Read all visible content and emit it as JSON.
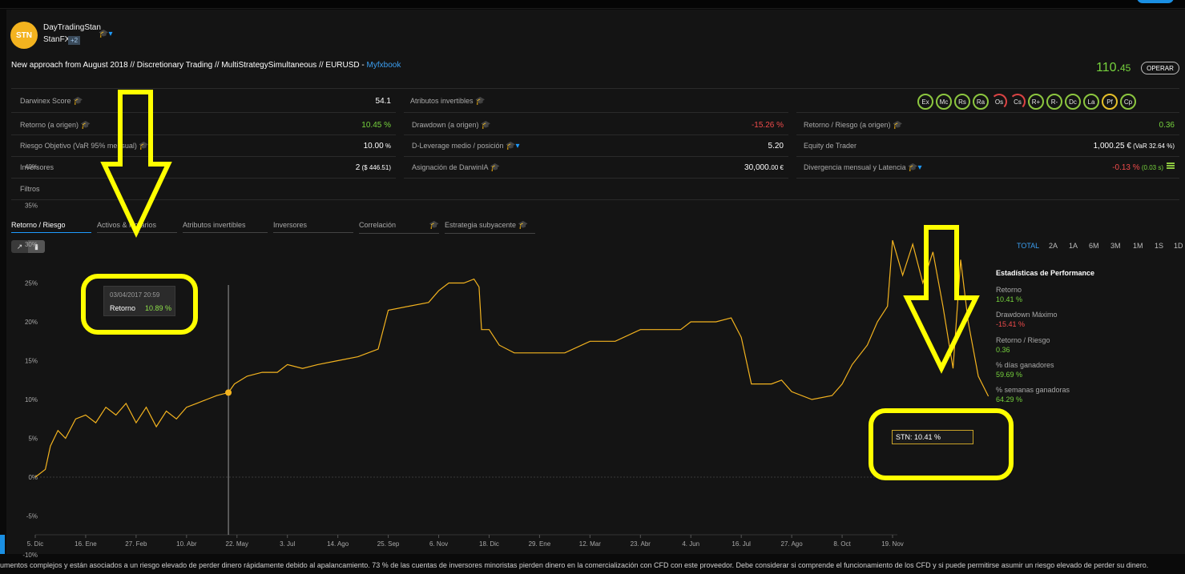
{
  "provider": {
    "avatar": "STN",
    "name": "DayTradingStan",
    "account": "StanFX",
    "plus": "+2"
  },
  "description": {
    "text": "New approach from August 2018 // Discretionary Trading // MultiStrategySimultaneous // EURUSD - ",
    "link": "Myfxbook"
  },
  "price": {
    "main": "110.",
    "decimals": "45"
  },
  "operar_label": "OPERAR",
  "stats": {
    "darwinex_score": {
      "label": "Darwinex Score",
      "value": "54.1"
    },
    "atributos": {
      "label": "Atributos invertibles"
    },
    "retorno": {
      "label": "Retorno (a origen)",
      "value": "10.45 %"
    },
    "drawdown": {
      "label": "Drawdown (a origen)",
      "value": "-15.26 %"
    },
    "retorno_riesgo": {
      "label": "Retorno / Riesgo (a origen)",
      "value": "0.36"
    },
    "riesgo_objetivo": {
      "label": "Riesgo Objetivo (VaR 95% mensual)",
      "value_main": "10.00",
      "value_unit": " %"
    },
    "d_leverage": {
      "label": "D-Leverage medio / posición",
      "value": "5.20"
    },
    "equity": {
      "label": "Equity de Trader",
      "value_main": "1,000.25 €",
      "value_extra": " (VaR 32.64 %)"
    },
    "inversores": {
      "label": "Inversores",
      "value_main": "2",
      "value_extra": " ($ 446.51)"
    },
    "asignacion": {
      "label": "Asignación de DarwinIA",
      "value_main": "30,000.",
      "value_extra": "00 €"
    },
    "divergencia": {
      "label": "Divergencia mensual y Latencia",
      "value_main": "-0.13 %",
      "value_extra": " (0.03 s)"
    },
    "filtros": {
      "label": "Filtros"
    }
  },
  "badges": [
    {
      "label": "Ex",
      "color": "green"
    },
    {
      "label": "Mc",
      "color": "green"
    },
    {
      "label": "Rs",
      "color": "green"
    },
    {
      "label": "Ra",
      "color": "green"
    },
    {
      "label": "Os",
      "color": "red"
    },
    {
      "label": "Cs",
      "color": "red"
    },
    {
      "label": "R+",
      "color": "green"
    },
    {
      "label": "R-",
      "color": "green"
    },
    {
      "label": "Dc",
      "color": "green"
    },
    {
      "label": "La",
      "color": "green"
    },
    {
      "label": "Pf",
      "color": "yellow"
    },
    {
      "label": "Cp",
      "color": "green"
    }
  ],
  "tabs": [
    "Retorno / Riesgo",
    "Activos & Horarios",
    "Atributos invertibles",
    "Inversores",
    "Correlación",
    "Estrategia subyacente"
  ],
  "ranges": [
    "TOTAL",
    "2A",
    "1A",
    "6M",
    "3M",
    "1M",
    "1S",
    "1D"
  ],
  "performance": {
    "title": "Estadísticas de Performance",
    "items": [
      {
        "label": "Retorno",
        "value": "10.41 %"
      },
      {
        "label": "Drawdown Máximo",
        "value": "-15.41 %"
      },
      {
        "label": "Retorno / Riesgo",
        "value": "0.36"
      },
      {
        "label": "% días ganadores",
        "value": "59.69 %"
      },
      {
        "label": "% semanas ganadoras",
        "value": "64.29 %"
      }
    ]
  },
  "tooltip": {
    "date": "03/04/2017 20:59",
    "label": "Retorno",
    "value": "10.89 %"
  },
  "stn_label": "STN: 10.41 %",
  "disclaimer": "umentos complejos y están asociados a un riesgo elevado de perder dinero rápidamente debido al apalancamiento. 73 % de las cuentas de inversores minoristas pierden dinero en la comercialización con CFD con este proveedor. Debe considerar si comprende el funcionamiento de los CFD y si puede permitirse asumir un riesgo elevado de perder su dinero.",
  "colors": {
    "accent": "#1e9bff",
    "positive": "#76d23d",
    "negative": "#f04b4b",
    "line": "#f3b31f",
    "annotation": "#ffff00"
  },
  "chart_data": {
    "type": "line",
    "ylim": [
      -12,
      42
    ],
    "yticks": [
      40,
      35,
      30,
      25,
      20,
      15,
      10,
      5,
      0,
      -5,
      -10
    ],
    "ytick_labels": [
      "40%",
      "35%",
      "30%",
      "25%",
      "20%",
      "15%",
      "10%",
      "5%",
      "0%",
      "-5%",
      "-10%"
    ],
    "xticks": [
      "5. Dic",
      "16. Ene",
      "27. Feb",
      "10. Abr",
      "22. May",
      "3. Jul",
      "14. Ago",
      "25. Sep",
      "6. Nov",
      "18. Dic",
      "29. Ene",
      "12. Mar",
      "23. Abr",
      "4. Jun",
      "16. Jul",
      "27. Ago",
      "8. Oct",
      "19. Nov"
    ],
    "x_range": [
      0,
      17.7
    ],
    "series": [
      {
        "name": "STN",
        "points": [
          [
            0.0,
            0
          ],
          [
            0.2,
            1
          ],
          [
            0.3,
            4
          ],
          [
            0.45,
            6
          ],
          [
            0.6,
            5
          ],
          [
            0.8,
            7.5
          ],
          [
            1.0,
            8
          ],
          [
            1.2,
            7
          ],
          [
            1.4,
            9
          ],
          [
            1.6,
            8
          ],
          [
            1.8,
            9.5
          ],
          [
            2.0,
            7
          ],
          [
            2.2,
            9
          ],
          [
            2.4,
            6.5
          ],
          [
            2.6,
            8.5
          ],
          [
            2.8,
            7.5
          ],
          [
            3.0,
            9
          ],
          [
            3.2,
            9.5
          ],
          [
            3.4,
            10
          ],
          [
            3.6,
            10.5
          ],
          [
            3.83,
            10.89
          ],
          [
            3.95,
            12
          ],
          [
            4.2,
            13
          ],
          [
            4.5,
            13.5
          ],
          [
            4.8,
            13.5
          ],
          [
            5.0,
            14.5
          ],
          [
            5.3,
            14
          ],
          [
            5.6,
            14.5
          ],
          [
            6.0,
            15
          ],
          [
            6.4,
            15.5
          ],
          [
            6.8,
            16.5
          ],
          [
            7.0,
            21.5
          ],
          [
            7.4,
            22
          ],
          [
            7.8,
            22.5
          ],
          [
            8.0,
            24
          ],
          [
            8.2,
            25
          ],
          [
            8.5,
            25
          ],
          [
            8.7,
            25.5
          ],
          [
            8.8,
            24.5
          ],
          [
            8.85,
            19
          ],
          [
            9.0,
            19
          ],
          [
            9.2,
            17
          ],
          [
            9.5,
            16
          ],
          [
            10.0,
            16
          ],
          [
            10.5,
            16
          ],
          [
            11.0,
            17.5
          ],
          [
            11.5,
            17.5
          ],
          [
            12.0,
            19
          ],
          [
            12.5,
            19
          ],
          [
            12.8,
            19
          ],
          [
            13.0,
            20
          ],
          [
            13.5,
            20
          ],
          [
            13.8,
            20.5
          ],
          [
            14.0,
            18
          ],
          [
            14.2,
            12
          ],
          [
            14.6,
            12
          ],
          [
            14.8,
            12.5
          ],
          [
            15.0,
            11
          ],
          [
            15.4,
            10
          ],
          [
            15.8,
            10.5
          ],
          [
            16.0,
            12
          ],
          [
            16.2,
            14.5
          ],
          [
            16.5,
            17
          ],
          [
            16.7,
            20
          ],
          [
            16.9,
            22
          ],
          [
            17.0,
            30.5
          ],
          [
            17.2,
            26
          ],
          [
            17.4,
            30
          ],
          [
            17.6,
            25
          ],
          [
            17.8,
            29
          ],
          [
            18.0,
            22
          ],
          [
            18.2,
            14
          ],
          [
            18.35,
            28
          ],
          [
            18.5,
            20
          ],
          [
            18.7,
            13
          ],
          [
            18.9,
            10.41
          ]
        ]
      }
    ]
  }
}
